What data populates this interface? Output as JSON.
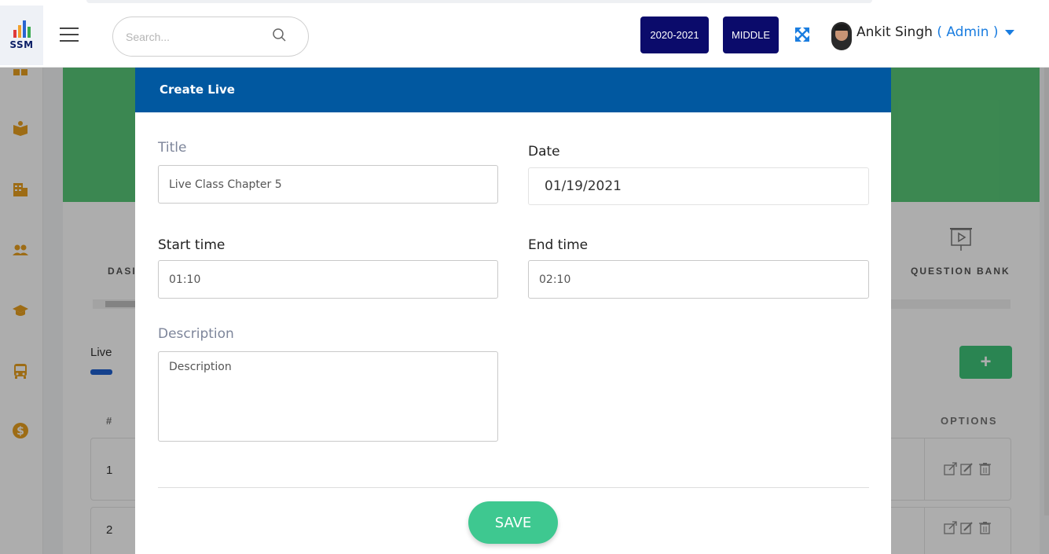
{
  "app": {
    "logo_text": "SSM"
  },
  "search": {
    "placeholder": "Search..."
  },
  "header": {
    "session_label": "2020-2021",
    "level_label": "MIDDLE",
    "user_name": "Ankit Singh",
    "user_role": "( Admin )"
  },
  "background": {
    "tiles": {
      "left_label_partial": "DASI",
      "right_label": "QUESTION BANK"
    },
    "tab_label": "Live",
    "add_label": "+",
    "table": {
      "headers": {
        "num": "#",
        "options": "OPTIONS"
      },
      "rows": [
        {
          "num": "1"
        },
        {
          "num": "2"
        }
      ]
    }
  },
  "modal": {
    "title": "Create Live",
    "title_label": "Title",
    "title_value": "Live Class Chapter 5",
    "date_label": "Date",
    "date_value": "01/19/2021",
    "start_label": "Start time",
    "start_value": "01:10",
    "end_label": "End time",
    "end_value": "02:10",
    "description_label": "Description",
    "description_placeholder": "Description",
    "save_label": "SAVE"
  },
  "colors": {
    "header_blue": "#0158a0",
    "navy_pill": "#0b0b6b",
    "accent_blue": "#1a7de0",
    "save_green": "#3ec890",
    "banner_green": "#58c878",
    "sidebar_icon_orange": "#e8a020"
  },
  "icons": {
    "sidebar": [
      "dashboard-icon",
      "book-icon",
      "building-icon",
      "users-icon",
      "graduation-cap-icon",
      "bus-icon",
      "dollar-icon"
    ],
    "header": [
      "search-icon",
      "expand-icon",
      "avatar",
      "caret-down-icon"
    ],
    "row_options": [
      "share-icon",
      "edit-icon",
      "trash-icon"
    ]
  }
}
